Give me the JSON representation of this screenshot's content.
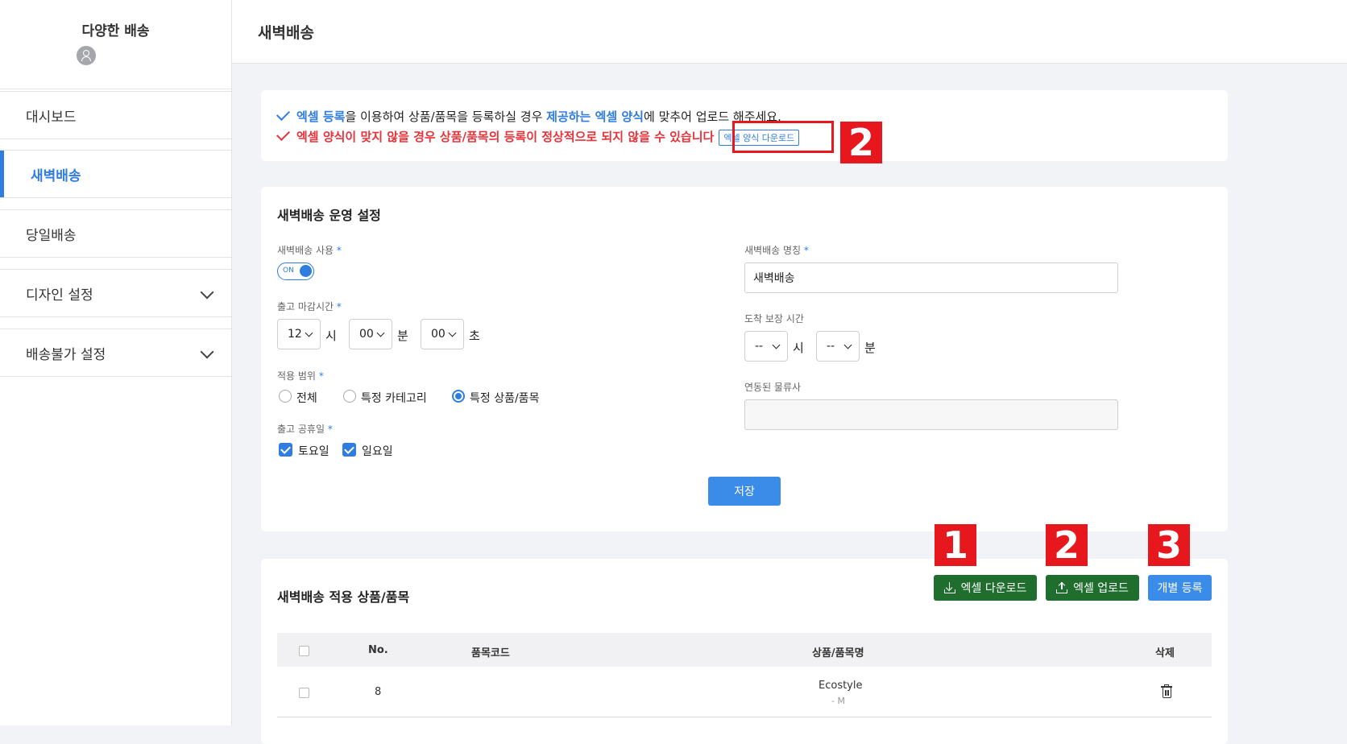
{
  "sidebar": {
    "brand_title": "다양한 배송",
    "items": [
      {
        "label": "대시보드"
      },
      {
        "label": "새벽배송"
      },
      {
        "label": "당일배송"
      },
      {
        "label": "디자인 설정"
      },
      {
        "label": "배송불가 설정"
      }
    ]
  },
  "header": {
    "title": "새벽배송"
  },
  "notice": {
    "line1": {
      "part1": "엑셀 등록",
      "part2": "을 이용하여 상품/품목을 등록하실 경우 ",
      "part3": "제공하는 엑셀 양식",
      "part4": "에 맞추어 업로드 해주세요."
    },
    "line2": {
      "text": "엑셀 양식이 맞지 않을 경우 상품/품목의 등록이 정상적으로 되지 않을 수 있습니다",
      "link": "엑셀 양식 다운로드"
    },
    "badge": "2"
  },
  "settings": {
    "title": "새벽배송 운영 설정",
    "use_label": "새벽배송 사용",
    "toggle_text": "ON",
    "cutoff_label": "출고 마감시간",
    "cutoff": {
      "hour": "12",
      "hour_unit": "시",
      "minute": "00",
      "minute_unit": "분",
      "second": "00",
      "second_unit": "초"
    },
    "scope_label": "적용 범위",
    "scope_options": [
      {
        "label": "전체",
        "checked": false
      },
      {
        "label": "특정 카테고리",
        "checked": false
      },
      {
        "label": "특정 상품/품목",
        "checked": true
      }
    ],
    "holiday_label": "출고 공휴일",
    "holidays": [
      {
        "label": "토요일",
        "checked": true
      },
      {
        "label": "일요일",
        "checked": true
      }
    ],
    "name_label": "새벽배송 명칭",
    "name_value": "새벽배송",
    "arrival_label": "도착 보장 시간",
    "arrival": {
      "hour": "--",
      "hour_unit": "시",
      "minute": "--",
      "minute_unit": "분"
    },
    "carrier_label": "연동된 물류사",
    "carrier_value": "",
    "required_mark": "*",
    "save_label": "저장"
  },
  "products": {
    "title": "새벽배송 적용 상품/품목",
    "buttons": {
      "excel_download": "엑셀 다운로드",
      "excel_upload": "엑셀 업로드",
      "individual": "개별 등록"
    },
    "badges": [
      "1",
      "2",
      "3"
    ],
    "columns": [
      "No.",
      "품목코드",
      "상품/품목명",
      "삭제"
    ],
    "rows": [
      {
        "no": "8",
        "code": "",
        "name": "Ecostyle",
        "option": "- M"
      }
    ]
  },
  "colors": {
    "accent": "#2f7de1",
    "warning": "#e8333a",
    "excel_green": "#1f6e2e",
    "annotation_red": "#e6181e"
  }
}
